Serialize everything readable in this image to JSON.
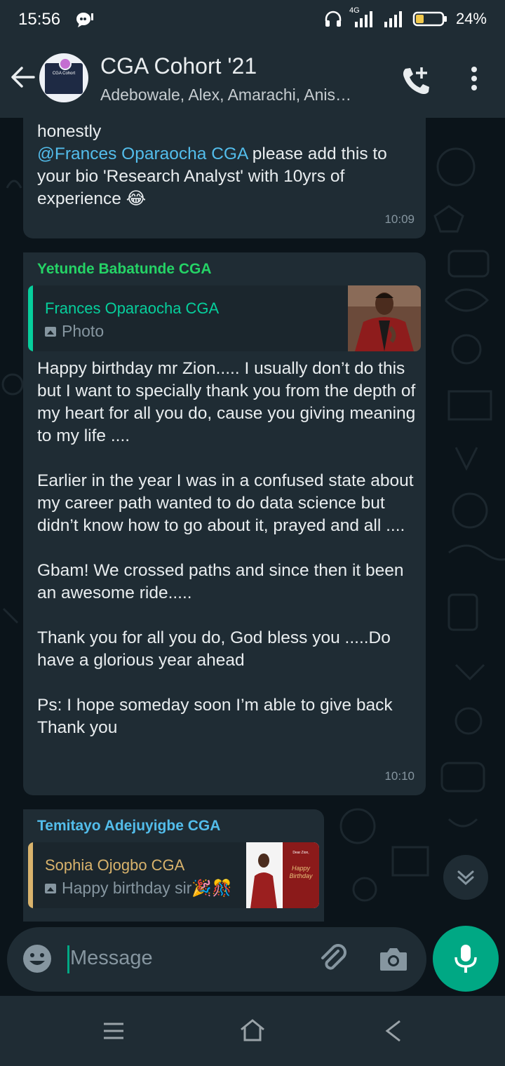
{
  "status_bar": {
    "time": "15:56",
    "network": "4G",
    "battery": "24%"
  },
  "header": {
    "title": "CGA Cohort '21",
    "participants": "Adebowale, Alex, Amarachi, Anis…",
    "avatar_text": "CGA Cohort"
  },
  "messages": [
    {
      "text_before": "honestly\n",
      "mention": "@Frances Oparaocha CGA",
      "text_after": " please add this to your bio 'Research Analyst' with 10yrs of experience 😂",
      "time": "10:09"
    },
    {
      "sender": "Yetunde Babatunde CGA",
      "sender_color": "#25d366",
      "quoted_sender": "Frances Oparaocha CGA",
      "quoted_color": "#06cf9c",
      "quoted_text": "Photo",
      "text": "Happy birthday mr Zion..... I usually don’t do this but I want to specially thank you from the depth of my heart for all you do, cause you giving meaning to my life ....\n\nEarlier in the year I was in a confused state about my career path wanted to do data science but didn’t know how to go about it, prayed and all ....\n\nGbam! We crossed paths and since then it been an awesome ride.....\n\nThank you for all you do, God bless you .....Do have a glorious year ahead\n\nPs: I hope someday soon I’m able to give back\nThank you",
      "time": "10:10"
    },
    {
      "sender": "Temitayo Adejuyigbe CGA",
      "sender_color": "#53bdeb",
      "quoted_sender": "Sophia Ojogbo CGA",
      "quoted_color": "#d9b36c",
      "quoted_text": "Happy birthday sir🎉🎊",
      "card_text": "Dear Zion,",
      "card_script": "Happy Birthday"
    }
  ],
  "composer": {
    "placeholder": "Message"
  }
}
